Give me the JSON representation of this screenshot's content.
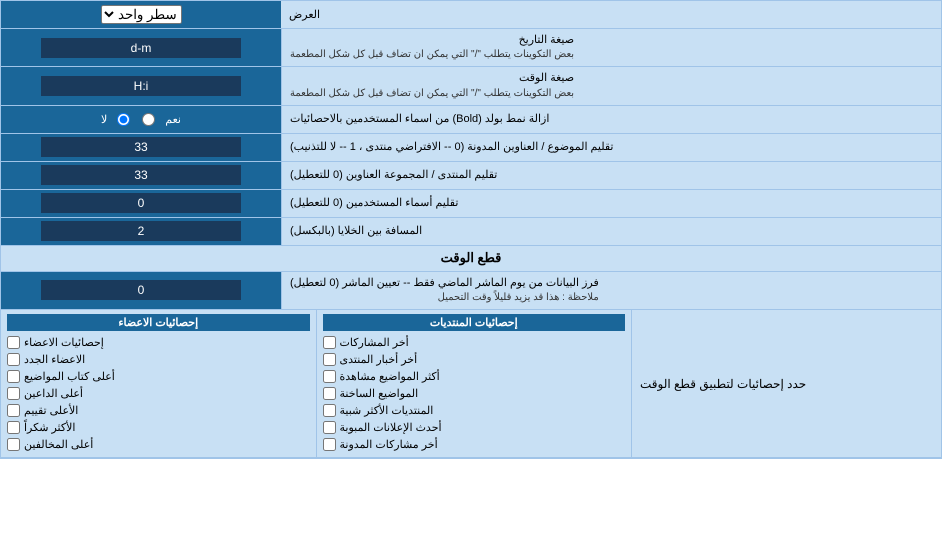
{
  "header": {
    "title": "العرض",
    "select_label": "سطر واحد"
  },
  "rows": [
    {
      "id": "date_format",
      "label": "صيغة التاريخ",
      "sublabel": "بعض التكوينات يتطلب \"/\" التي يمكن ان تضاف قبل كل شكل المطعمة",
      "value": "d-m"
    },
    {
      "id": "time_format",
      "label": "صيغة الوقت",
      "sublabel": "بعض التكوينات يتطلب \"/\" التي يمكن ان تضاف قبل كل شكل المطعمة",
      "value": "H:i"
    },
    {
      "id": "bold_remove",
      "label": "ازالة نمط بولد (Bold) من اسماء المستخدمين بالاحصائيات",
      "radio_yes": "نعم",
      "radio_no": "لا",
      "selected": "no"
    },
    {
      "id": "subject_count",
      "label": "تقليم الموضوع / العناوين المدونة (0 -- الافتراضي منتدى ، 1 -- لا للتذنيب)",
      "value": "33"
    },
    {
      "id": "forum_members",
      "label": "تقليم المنتدى / المجموعة العناوين (0 للتعطيل)",
      "value": "33"
    },
    {
      "id": "user_names",
      "label": "تقليم أسماء المستخدمين (0 للتعطيل)",
      "value": "0"
    },
    {
      "id": "cell_spacing",
      "label": "المسافة بين الخلايا (بالبكسل)",
      "value": "2"
    }
  ],
  "cutoff_section": {
    "title": "قطع الوقت",
    "row": {
      "label": "فرز البيانات من يوم الماشر الماضي فقط -- تعيين الماشر (0 لتعطيل)\nملاحظة : هذا قد يزيد قليلاً وقت التحميل",
      "value": "0"
    },
    "limit_title": "حدد إحصائيات لتطبيق قطع الوقت"
  },
  "stats_columns": {
    "posts_header": "إحصائيات المنتديات",
    "members_header": "إحصائيات الاعضاء",
    "posts_items": [
      {
        "id": "latest_posts",
        "label": "أخر المشاركات"
      },
      {
        "id": "latest_forum_news",
        "label": "أخر أخبار المنتدى"
      },
      {
        "id": "most_viewed",
        "label": "أكثر المواضيع مشاهدة"
      },
      {
        "id": "hot_topics",
        "label": "المواضيع الساخنة"
      },
      {
        "id": "similar_forums",
        "label": "المنتديات الأكثر شبية"
      },
      {
        "id": "latest_ads",
        "label": "أحدث الإعلانات المبوبة"
      },
      {
        "id": "latest_marked",
        "label": "أخر مشاركات المدونة"
      }
    ],
    "members_items": [
      {
        "id": "members_stats",
        "label": "إحصائيات الاعضاء"
      },
      {
        "id": "new_members",
        "label": "الاعضاء الجدد"
      },
      {
        "id": "top_posters",
        "label": "أعلى كتاب المواضيع"
      },
      {
        "id": "top_online",
        "label": "أعلى الداعين"
      },
      {
        "id": "top_rated",
        "label": "الأعلى تقييم"
      },
      {
        "id": "most_thanked",
        "label": "الأكثر شكراً"
      },
      {
        "id": "top_referred",
        "label": "أعلى المخالفين"
      }
    ]
  }
}
